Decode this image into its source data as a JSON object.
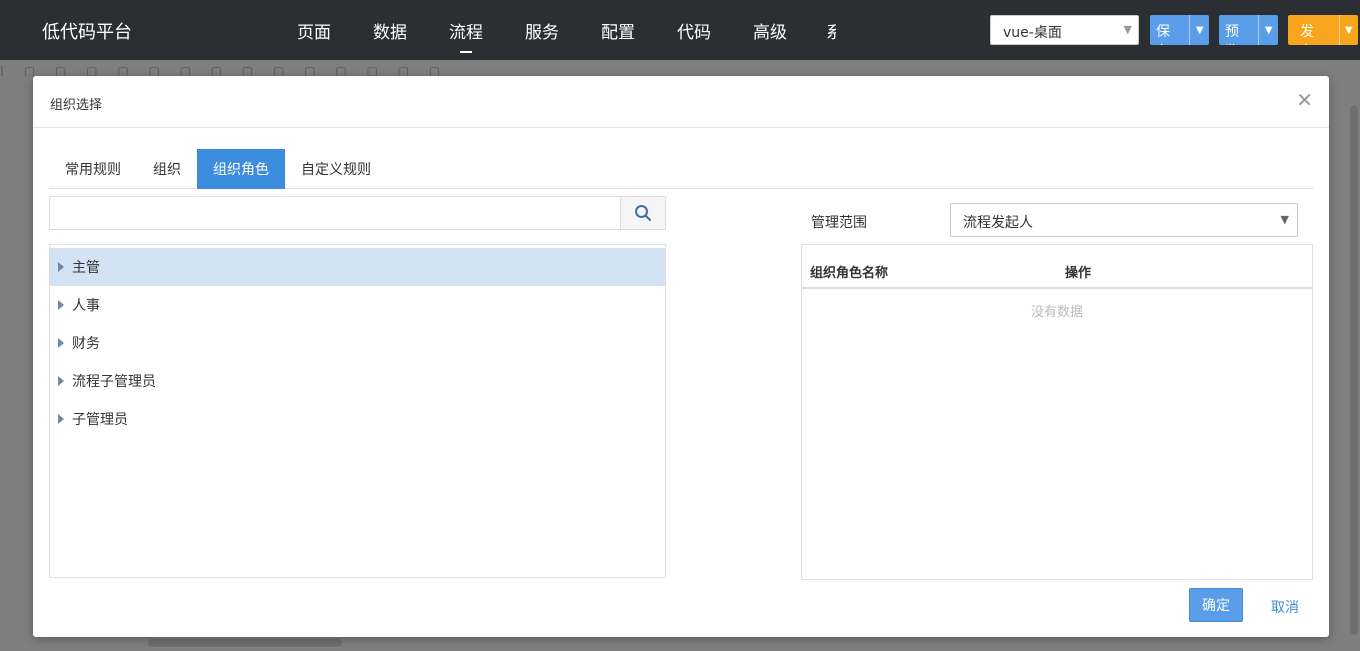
{
  "app": {
    "title": "低代码平台"
  },
  "nav": {
    "items": [
      {
        "label": "页面"
      },
      {
        "label": "数据"
      },
      {
        "label": "流程",
        "active": true
      },
      {
        "label": "服务"
      },
      {
        "label": "配置"
      },
      {
        "label": "代码"
      },
      {
        "label": "高级"
      }
    ],
    "clipped": "系"
  },
  "toolbar": {
    "env_value": "vue-桌面",
    "save_label": "保存",
    "preview_label": "预览",
    "publish_label": "发布"
  },
  "modal": {
    "title": "组织选择",
    "tabs": [
      {
        "label": "常用规则"
      },
      {
        "label": "组织"
      },
      {
        "label": "组织角色",
        "active": true
      },
      {
        "label": "自定义规则"
      }
    ],
    "search": {
      "value": "",
      "placeholder": ""
    },
    "tree": [
      {
        "label": "主管",
        "selected": true
      },
      {
        "label": "人事"
      },
      {
        "label": "财务"
      },
      {
        "label": "流程子管理员"
      },
      {
        "label": "子管理员"
      }
    ],
    "scope": {
      "label": "管理范围",
      "value": "流程发起人"
    },
    "table": {
      "columns": [
        "组织角色名称",
        "操作"
      ],
      "empty_text": "没有数据"
    },
    "ok_label": "确定",
    "cancel_label": "取消"
  },
  "colors": {
    "accent": "#3c8dde",
    "publish": "#f7a51c",
    "topbar": "#2b2e33"
  }
}
